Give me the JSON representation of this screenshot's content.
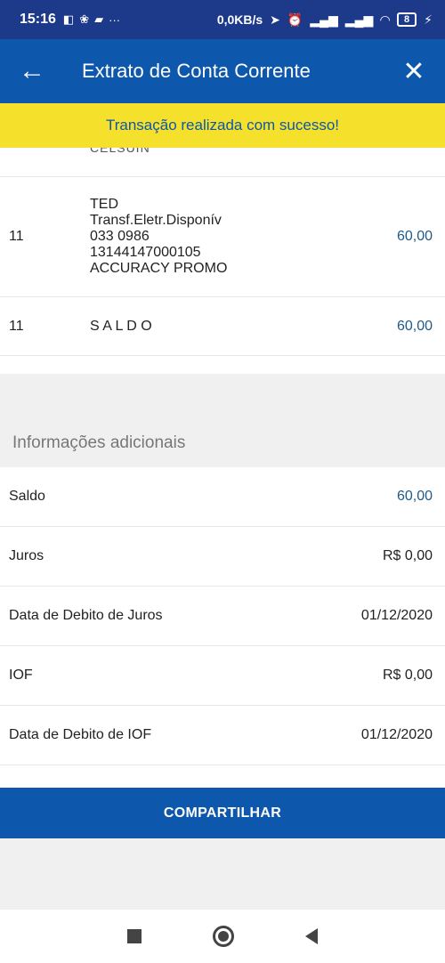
{
  "status_bar": {
    "time": "15:16",
    "net_speed": "0,0KB/s",
    "battery": "8"
  },
  "app_bar": {
    "title": "Extrato de Conta Corrente"
  },
  "banner": {
    "message": "Transação realizada com sucesso!"
  },
  "statement": {
    "partial_top_text": "CELSUIN",
    "rows": [
      {
        "day": "11",
        "lines": [
          "TED",
          "Transf.Eletr.Disponív",
          "033 0986",
          "13144147000105",
          "ACCURACY PROMO"
        ],
        "amount": "60,00"
      },
      {
        "day": "11",
        "label": "S A L D O",
        "amount": "60,00"
      }
    ]
  },
  "additional_info": {
    "title": "Informações adicionais",
    "items": [
      {
        "label": "Saldo",
        "value": "60,00"
      },
      {
        "label": "Juros",
        "value": "R$ 0,00"
      },
      {
        "label": "Data de Debito de Juros",
        "value": "01/12/2020"
      },
      {
        "label": "IOF",
        "value": "R$ 0,00"
      },
      {
        "label": "Data de Debito de IOF",
        "value": "01/12/2020"
      }
    ]
  },
  "share_button": {
    "label": "COMPARTILHAR"
  },
  "colors": {
    "primary": "#0d57ad",
    "banner": "#f5e12b",
    "amount": "#1d5a8a"
  }
}
